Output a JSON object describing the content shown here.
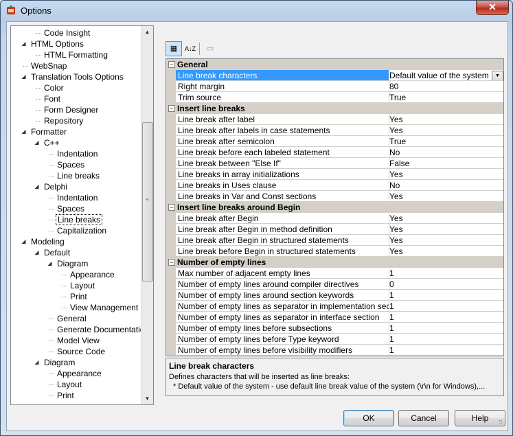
{
  "window": {
    "title": "Options",
    "close_label": "✕"
  },
  "tree": {
    "items": [
      {
        "label": "Code Insight",
        "indent": 2,
        "exp": ""
      },
      {
        "label": "HTML Options",
        "indent": 1,
        "exp": "◢"
      },
      {
        "label": "HTML Formatting",
        "indent": 2,
        "exp": ""
      },
      {
        "label": "WebSnap",
        "indent": 1,
        "exp": ""
      },
      {
        "label": "Translation Tools Options",
        "indent": 1,
        "exp": "◢"
      },
      {
        "label": "Color",
        "indent": 2,
        "exp": ""
      },
      {
        "label": "Font",
        "indent": 2,
        "exp": ""
      },
      {
        "label": "Form Designer",
        "indent": 2,
        "exp": ""
      },
      {
        "label": "Repository",
        "indent": 2,
        "exp": ""
      },
      {
        "label": "Formatter",
        "indent": 1,
        "exp": "◢"
      },
      {
        "label": "C++",
        "indent": 2,
        "exp": "◢"
      },
      {
        "label": "Indentation",
        "indent": 3,
        "exp": ""
      },
      {
        "label": "Spaces",
        "indent": 3,
        "exp": ""
      },
      {
        "label": "Line breaks",
        "indent": 3,
        "exp": ""
      },
      {
        "label": "Delphi",
        "indent": 2,
        "exp": "◢"
      },
      {
        "label": "Indentation",
        "indent": 3,
        "exp": ""
      },
      {
        "label": "Spaces",
        "indent": 3,
        "exp": ""
      },
      {
        "label": "Line breaks",
        "indent": 3,
        "exp": "",
        "selected": true
      },
      {
        "label": "Capitalization",
        "indent": 3,
        "exp": ""
      },
      {
        "label": "Modeling",
        "indent": 1,
        "exp": "◢"
      },
      {
        "label": "Default",
        "indent": 2,
        "exp": "◢"
      },
      {
        "label": "Diagram",
        "indent": 3,
        "exp": "◢"
      },
      {
        "label": "Appearance",
        "indent": 4,
        "exp": ""
      },
      {
        "label": "Layout",
        "indent": 4,
        "exp": ""
      },
      {
        "label": "Print",
        "indent": 4,
        "exp": ""
      },
      {
        "label": "View Management",
        "indent": 4,
        "exp": ""
      },
      {
        "label": "General",
        "indent": 3,
        "exp": ""
      },
      {
        "label": "Generate Documentation",
        "indent": 3,
        "exp": ""
      },
      {
        "label": "Model View",
        "indent": 3,
        "exp": ""
      },
      {
        "label": "Source Code",
        "indent": 3,
        "exp": ""
      },
      {
        "label": "Diagram",
        "indent": 2,
        "exp": "◢"
      },
      {
        "label": "Appearance",
        "indent": 3,
        "exp": ""
      },
      {
        "label": "Layout",
        "indent": 3,
        "exp": ""
      },
      {
        "label": "Print",
        "indent": 3,
        "exp": ""
      }
    ]
  },
  "toolbar": {
    "categorized_icon": "▦",
    "alphabetical_icon": "A↓Z",
    "property_pages_icon": "▭"
  },
  "grid": {
    "rows": [
      {
        "type": "cat",
        "label": "General"
      },
      {
        "type": "prop",
        "name": "Line break characters",
        "value": "Default value of the system",
        "selected": true,
        "dropdown": true
      },
      {
        "type": "prop",
        "name": "Right margin",
        "value": "80"
      },
      {
        "type": "prop",
        "name": "Trim source",
        "value": "True"
      },
      {
        "type": "cat",
        "label": "Insert line breaks"
      },
      {
        "type": "prop",
        "name": "Line break after label",
        "value": "Yes"
      },
      {
        "type": "prop",
        "name": "Line break after labels in case statements",
        "value": "Yes"
      },
      {
        "type": "prop",
        "name": "Line break after semicolon",
        "value": "True"
      },
      {
        "type": "prop",
        "name": "Line break before each labeled statement",
        "value": "No"
      },
      {
        "type": "prop",
        "name": "Line break between \"Else If\"",
        "value": "False"
      },
      {
        "type": "prop",
        "name": "Line breaks in array initializations",
        "value": "Yes"
      },
      {
        "type": "prop",
        "name": "Line breaks in Uses clause",
        "value": "No"
      },
      {
        "type": "prop",
        "name": "Line breaks in Var and Const sections",
        "value": "Yes"
      },
      {
        "type": "cat",
        "label": "Insert line breaks around Begin"
      },
      {
        "type": "prop",
        "name": "Line break after Begin",
        "value": "Yes"
      },
      {
        "type": "prop",
        "name": "Line break after Begin in method definition",
        "value": "Yes"
      },
      {
        "type": "prop",
        "name": "Line break after Begin in structured statements",
        "value": "Yes"
      },
      {
        "type": "prop",
        "name": "Line break before Begin in structured statements",
        "value": "Yes"
      },
      {
        "type": "cat",
        "label": "Number of empty lines"
      },
      {
        "type": "prop",
        "name": "Max number of adjacent empty lines",
        "value": "1"
      },
      {
        "type": "prop",
        "name": "Number of empty lines around compiler directives",
        "value": "0"
      },
      {
        "type": "prop",
        "name": "Number of empty lines around section keywords",
        "value": "1"
      },
      {
        "type": "prop",
        "name": "Number of empty lines as separator in implementation section",
        "value": "1"
      },
      {
        "type": "prop",
        "name": "Number of empty lines as separator in interface section",
        "value": "1"
      },
      {
        "type": "prop",
        "name": "Number of empty lines before subsections",
        "value": "1"
      },
      {
        "type": "prop",
        "name": "Number of empty lines before Type keyword",
        "value": "1"
      },
      {
        "type": "prop",
        "name": "Number of empty lines before visibility modifiers",
        "value": "1"
      }
    ]
  },
  "description": {
    "title": "Line break characters",
    "line1": "Defines characters that will be inserted as line breaks:",
    "line2": "* Default value of the system - use default line break value of the system (\\r\\n for Windows),..."
  },
  "buttons": {
    "ok": "OK",
    "cancel": "Cancel",
    "help": "Help"
  }
}
